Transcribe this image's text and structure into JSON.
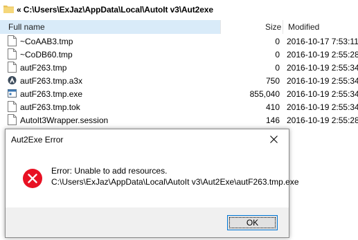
{
  "path": {
    "text": "« C:\\Users\\ExJaz\\AppData\\Local\\AutoIt v3\\Aut2exe"
  },
  "columns": {
    "name": "Full name",
    "size": "Size",
    "modified": "Modified"
  },
  "files": [
    {
      "name": "~CoAAB3.tmp",
      "size": "0",
      "modified": "2016-10-17 7:53:11",
      "icon": "file-icon"
    },
    {
      "name": "~CoDB60.tmp",
      "size": "0",
      "modified": "2016-10-19 2:55:28",
      "icon": "file-icon"
    },
    {
      "name": "autF263.tmp",
      "size": "0",
      "modified": "2016-10-19 2:55:34",
      "icon": "file-icon"
    },
    {
      "name": "autF263.tmp.a3x",
      "size": "750",
      "modified": "2016-10-19 2:55:34",
      "icon": "autoit-script-icon"
    },
    {
      "name": "autF263.tmp.exe",
      "size": "855,040",
      "modified": "2016-10-19 2:55:34",
      "icon": "exe-icon"
    },
    {
      "name": "autF263.tmp.tok",
      "size": "410",
      "modified": "2016-10-19 2:55:34",
      "icon": "file-icon"
    },
    {
      "name": "AutoIt3Wrapper.session",
      "size": "146",
      "modified": "2016-10-19 2:55:28",
      "icon": "file-icon"
    }
  ],
  "dialog": {
    "title": "Aut2Exe Error",
    "message_line1": "Error: Unable to add resources.",
    "message_line2": "C:\\Users\\ExJaz\\AppData\\Local\\AutoIt v3\\Aut2Exe\\autF263.tmp.exe",
    "ok_label": "OK",
    "icon": "error-icon",
    "close_icon": "close-icon"
  },
  "colors": {
    "header_highlight": "#d9ebf9",
    "error_red": "#e81123",
    "ok_border": "#0078d7"
  }
}
